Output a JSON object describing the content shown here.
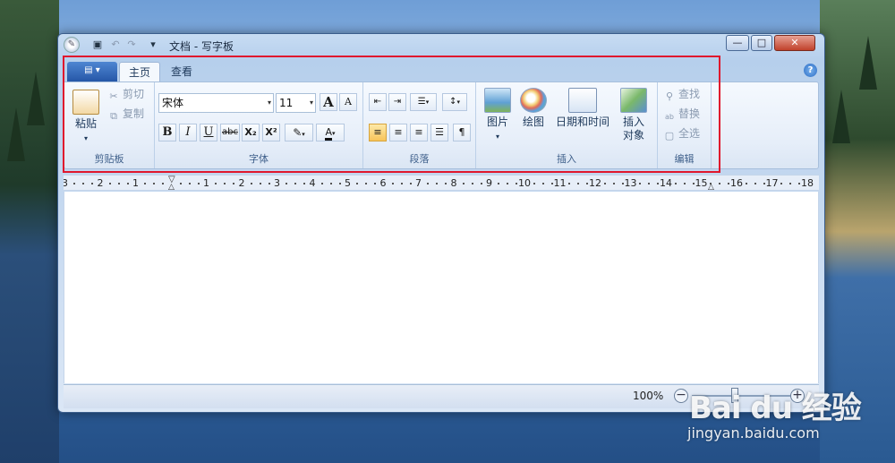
{
  "window": {
    "title": "文档 - 写字板",
    "min": "—",
    "max": "□",
    "close": "✕"
  },
  "tabs": {
    "file_menu": "▤ ▾",
    "items": [
      "主页",
      "查看"
    ],
    "help": "?"
  },
  "clipboard": {
    "paste": "粘贴",
    "paste_arrow": "▾",
    "cut": "剪切",
    "copy": "复制",
    "label": "剪贴板"
  },
  "font": {
    "family": "宋体",
    "size": "11",
    "grow": "A",
    "shrink": "A",
    "bold": "B",
    "italic": "I",
    "underline": "U",
    "strike": "abc",
    "subscript": "X₂",
    "superscript": "X²",
    "color_glyph": "A",
    "label": "字体"
  },
  "paragraph": {
    "label": "段落"
  },
  "insert": {
    "picture": "图片",
    "picture_arrow": "▾",
    "paint": "绘图",
    "datetime": "日期和时间",
    "object_line1": "插入",
    "object_line2": "对象",
    "label": "插入"
  },
  "editing": {
    "find": "查找",
    "replace": "替换",
    "select_all": "全选",
    "label": "编辑"
  },
  "ruler": {
    "left_marks": [
      "3",
      "2",
      "1"
    ],
    "right_marks": [
      "1",
      "2",
      "3",
      "4",
      "5",
      "6",
      "7",
      "8",
      "9",
      "10",
      "11",
      "12",
      "13",
      "14",
      "15",
      "16",
      "17",
      "18"
    ]
  },
  "status": {
    "zoom": "100%",
    "zoom_out": "−",
    "zoom_in": "+"
  },
  "watermark": {
    "logo": "Bai du 经验",
    "url": "jingyan.baidu.com"
  },
  "colors": {
    "highlight_border": "#e0182d",
    "file_tab": "#2557a7",
    "selected_align": "#f7c45a"
  }
}
